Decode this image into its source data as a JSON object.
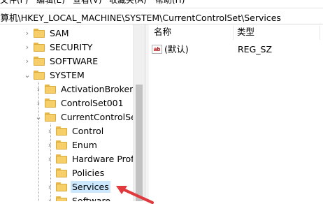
{
  "menu": [
    "文件(F)",
    "编辑(E)",
    "查看(V)",
    "收藏夹(A)",
    "帮助(H)"
  ],
  "address": "计算机\\HKEY_LOCAL_MACHINE\\SYSTEM\\CurrentControlSet\\Services",
  "tree": {
    "items": [
      {
        "label": "SAM",
        "expander": "collapsed"
      },
      {
        "label": "SECURITY",
        "expander": "collapsed"
      },
      {
        "label": "SOFTWARE",
        "expander": "collapsed"
      },
      {
        "label": "SYSTEM",
        "expander": "expanded"
      },
      {
        "label": "ActivationBroker",
        "expander": "collapsed"
      },
      {
        "label": "ControlSet001",
        "expander": "collapsed"
      },
      {
        "label": "CurrentControlSet",
        "expander": "expanded"
      },
      {
        "label": "Control",
        "expander": "collapsed"
      },
      {
        "label": "Enum",
        "expander": "collapsed"
      },
      {
        "label": "Hardware Profil",
        "expander": "collapsed"
      },
      {
        "label": "Policies",
        "expander": "none"
      },
      {
        "label": "Services",
        "expander": "collapsed",
        "selected": true
      },
      {
        "label": "Software",
        "expander": "collapsed"
      }
    ]
  },
  "values": {
    "headers": {
      "name": "名称",
      "type": "类型"
    },
    "rows": [
      {
        "icon": "ab",
        "name": "(默认)",
        "type": "REG_SZ"
      }
    ]
  },
  "colors": {
    "selection": "#cce8ff",
    "arrow": "#e0393e",
    "folder": "#f6cf6a"
  }
}
